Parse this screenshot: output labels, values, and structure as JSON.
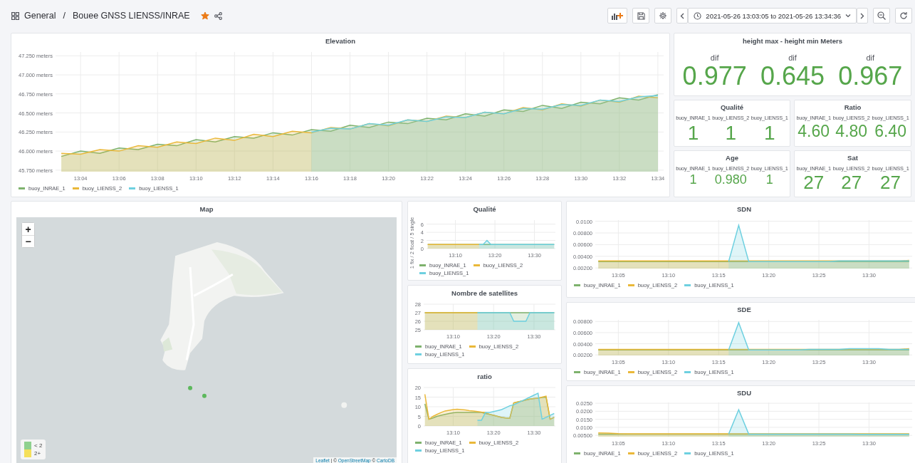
{
  "breadcrumb": {
    "folder": "General",
    "separator": "/",
    "dashboard": "Bouee GNSS LIENSS/INRAE",
    "starred": true
  },
  "time_range": "2021-05-26 13:03:05 to 2021-05-26 13:34:36",
  "elevation": {
    "title": "Elevation",
    "chart_data": {
      "type": "area",
      "grid": true,
      "ylim": [
        45.73,
        47.3
      ],
      "yticks": [
        {
          "value": 45.75,
          "label": "45.750 meters"
        },
        {
          "value": 46,
          "label": "46.000 meters"
        },
        {
          "value": 46.25,
          "label": "46.250 meters"
        },
        {
          "value": 46.5,
          "label": "46.500 meters"
        },
        {
          "value": 46.75,
          "label": "46.750 meters"
        },
        {
          "value": 47,
          "label": "47.000 meters"
        },
        {
          "value": 47.25,
          "label": "47.250 meters"
        }
      ],
      "categories": [
        null,
        "13:04",
        null,
        "13:06",
        null,
        "13:08",
        null,
        "13:10",
        null,
        "13:12",
        null,
        "13:14",
        null,
        "13:16",
        null,
        "13:18",
        null,
        "13:20",
        null,
        "13:22",
        null,
        "13:24",
        null,
        "13:26",
        null,
        "13:28",
        null,
        "13:30",
        null,
        "13:32",
        null,
        "13:34"
      ],
      "series": [
        {
          "name": "buoy_INRAE_1",
          "color": "#7eb26d",
          "values": [
            45.93,
            46.0,
            45.97,
            46.04,
            46.02,
            46.09,
            46.07,
            46.15,
            46.12,
            46.19,
            46.17,
            46.24,
            46.21,
            46.28,
            46.26,
            46.34,
            46.31,
            46.38,
            46.36,
            46.43,
            46.41,
            46.49,
            46.46,
            46.54,
            46.52,
            46.6,
            46.56,
            46.64,
            46.62,
            46.7,
            46.67,
            46.74
          ]
        },
        {
          "name": "buoy_LIENSS_2",
          "color": "#eab839",
          "values": [
            45.97,
            45.96,
            46.02,
            46.0,
            46.07,
            46.05,
            46.12,
            46.1,
            46.17,
            46.14,
            46.22,
            46.19,
            46.26,
            46.24,
            46.31,
            46.29,
            46.36,
            46.33,
            46.41,
            46.39,
            46.46,
            46.44,
            46.51,
            46.49,
            46.57,
            46.54,
            46.62,
            46.59,
            46.67,
            46.64,
            46.72,
            46.7
          ]
        },
        {
          "name": "buoy_LIENSS_1",
          "color": "#6ed0e0",
          "values": [
            null,
            null,
            null,
            null,
            null,
            null,
            null,
            null,
            null,
            null,
            null,
            null,
            null,
            46.25,
            46.3,
            46.29,
            46.36,
            46.34,
            46.41,
            46.39,
            46.45,
            46.44,
            46.51,
            46.49,
            46.56,
            46.55,
            46.61,
            46.6,
            46.67,
            46.65,
            46.71,
            46.73
          ]
        }
      ]
    }
  },
  "height_diff": {
    "title": "height max - height min Meters",
    "items": [
      {
        "label": "dif",
        "value": "0.977"
      },
      {
        "label": "dif",
        "value": "0.645"
      },
      {
        "label": "dif",
        "value": "0.967"
      }
    ]
  },
  "stat_panels": [
    {
      "title": "Qualité",
      "items": [
        {
          "label": "buoy_INRAE_1",
          "value": "1"
        },
        {
          "label": "buoy_LIENSS_2",
          "value": "1"
        },
        {
          "label": "buoy_LIENSS_1",
          "value": "1"
        }
      ]
    },
    {
      "title": "Ratio",
      "items": [
        {
          "label": "buoy_INRAE_1",
          "value": "4.60"
        },
        {
          "label": "buoy_LIENSS_2",
          "value": "4.80"
        },
        {
          "label": "buoy_LIENSS_1",
          "value": "6.40"
        }
      ]
    },
    {
      "title": "Age",
      "items": [
        {
          "label": "buoy_INRAE_1",
          "value": "1"
        },
        {
          "label": "buoy_LIENSS_2",
          "value": "0.980"
        },
        {
          "label": "buoy_LIENSS_1",
          "value": "1"
        }
      ]
    },
    {
      "title": "Sat",
      "items": [
        {
          "label": "buoy_INRAE_1",
          "value": "27"
        },
        {
          "label": "buoy_LIENSS_2",
          "value": "27"
        },
        {
          "label": "buoy_LIENSS_1",
          "value": "27"
        }
      ]
    }
  ],
  "map": {
    "title": "Map",
    "zoom_in": "+",
    "zoom_out": "−",
    "legend": [
      {
        "label": "< 2",
        "color": "#8fd18f"
      },
      {
        "label": "2+",
        "color": "#f5e05a"
      }
    ],
    "attribution": [
      {
        "kind": "link",
        "text": "Leaflet"
      },
      {
        "kind": "text",
        "text": " | © "
      },
      {
        "kind": "link",
        "text": "OpenStreetMap"
      },
      {
        "kind": "text",
        "text": " © "
      },
      {
        "kind": "link",
        "text": "CartoDB"
      }
    ]
  },
  "small_charts": [
    {
      "title": "Qualité",
      "chart_data": {
        "type": "area",
        "grid": true,
        "ylabel": "1 fix / 2 float / 5 single",
        "ylim": [
          0,
          7
        ],
        "yticks": [
          0,
          2,
          4,
          6
        ],
        "categories": [
          null,
          null,
          null,
          null,
          null,
          null,
          null,
          "13:10",
          null,
          null,
          null,
          null,
          null,
          null,
          null,
          null,
          null,
          "13:20",
          null,
          null,
          null,
          null,
          null,
          null,
          null,
          null,
          null,
          "13:30",
          null,
          null,
          null,
          null,
          null
        ],
        "series": [
          {
            "name": "buoy_INRAE_1",
            "color": "#7eb26d",
            "values": [
              1,
              1,
              1,
              1,
              1,
              1,
              1,
              1,
              1,
              1,
              1,
              1,
              1,
              1,
              1,
              1,
              1,
              1,
              1,
              1,
              1,
              1,
              1,
              1,
              1,
              1,
              1,
              1,
              1,
              1,
              1,
              1,
              1
            ]
          },
          {
            "name": "buoy_LIENSS_2",
            "color": "#eab839",
            "values": [
              1,
              1,
              1,
              1,
              1,
              1,
              1,
              1,
              1,
              1,
              1,
              1,
              1,
              1,
              null,
              null,
              null,
              null,
              null,
              null,
              null,
              null,
              null,
              null,
              null,
              null,
              null,
              null,
              null,
              null,
              null,
              null,
              null
            ]
          },
          {
            "name": "buoy_LIENSS_1",
            "color": "#6ed0e0",
            "values": [
              null,
              null,
              null,
              null,
              null,
              null,
              null,
              null,
              null,
              null,
              null,
              null,
              null,
              1,
              1,
              2,
              1,
              1,
              1,
              1,
              1,
              1,
              1,
              1,
              1,
              1,
              1,
              1,
              1,
              1,
              1,
              1,
              1
            ]
          }
        ]
      }
    },
    {
      "title": "Nombre de satellites",
      "chart_data": {
        "type": "area",
        "grid": true,
        "ylim": [
          25,
          28
        ],
        "yticks": [
          25,
          26,
          27,
          28
        ],
        "categories": [
          null,
          null,
          null,
          null,
          null,
          null,
          null,
          "13:10",
          null,
          null,
          null,
          null,
          null,
          null,
          null,
          null,
          null,
          "13:20",
          null,
          null,
          null,
          null,
          null,
          null,
          null,
          null,
          null,
          "13:30",
          null,
          null,
          null,
          null,
          null
        ],
        "series": [
          {
            "name": "buoy_INRAE_1",
            "color": "#7eb26d",
            "values": [
              27,
              27,
              27,
              27,
              27,
              27,
              27,
              27,
              27,
              27,
              27,
              27,
              27,
              27,
              27,
              27,
              27,
              27,
              27,
              27,
              27,
              27,
              27,
              27,
              27,
              27,
              27,
              27,
              27,
              27,
              27,
              27,
              27
            ]
          },
          {
            "name": "buoy_LIENSS_2",
            "color": "#eab839",
            "values": [
              27,
              27,
              27,
              27,
              27,
              27,
              27,
              27,
              27,
              27,
              27,
              27,
              27,
              27,
              null,
              null,
              null,
              null,
              null,
              null,
              null,
              null,
              null,
              null,
              null,
              null,
              null,
              null,
              null,
              null,
              null,
              null,
              null
            ]
          },
          {
            "name": "buoy_LIENSS_1",
            "color": "#6ed0e0",
            "values": [
              null,
              null,
              null,
              null,
              null,
              null,
              null,
              null,
              null,
              null,
              null,
              null,
              null,
              27,
              27,
              27,
              27,
              27,
              27,
              27,
              27,
              27,
              26,
              26,
              26,
              26,
              27,
              27,
              27,
              27,
              27,
              27,
              27
            ]
          }
        ]
      }
    },
    {
      "title": "ratio",
      "chart_data": {
        "type": "area",
        "grid": true,
        "ylim": [
          0,
          20
        ],
        "yticks": [
          0,
          5,
          10,
          15,
          20
        ],
        "categories": [
          null,
          null,
          null,
          null,
          null,
          null,
          null,
          "13:10",
          null,
          null,
          null,
          null,
          null,
          null,
          null,
          null,
          null,
          "13:20",
          null,
          null,
          null,
          null,
          null,
          null,
          null,
          null,
          null,
          "13:30",
          null,
          null,
          null,
          null,
          null
        ],
        "series": [
          {
            "name": "buoy_INRAE_1",
            "color": "#7eb26d",
            "values": [
              11.5,
              3.5,
              4.2,
              5,
              5.5,
              6,
              6.5,
              6.8,
              7,
              7,
              7,
              7,
              7,
              7,
              7,
              6.5,
              6,
              5.5,
              5,
              4.5,
              4.2,
              4,
              12,
              12.5,
              13,
              13.5,
              14,
              14.3,
              14.5,
              14.8,
              15,
              3.5,
              4.5
            ]
          },
          {
            "name": "buoy_LIENSS_2",
            "color": "#eab839",
            "values": [
              16.5,
              3.5,
              5,
              6,
              7,
              7.8,
              8.2,
              8.5,
              8.7,
              8.5,
              8.3,
              8,
              7.8,
              7.5,
              7.2,
              7,
              6,
              5.5,
              5,
              4.5,
              4.2,
              4,
              12,
              12.5,
              13,
              13.5,
              14,
              14.3,
              14.5,
              15,
              15.5,
              3.5,
              4.5
            ]
          },
          {
            "name": "buoy_LIENSS_1",
            "color": "#6ed0e0",
            "values": [
              null,
              null,
              null,
              null,
              null,
              null,
              null,
              null,
              null,
              null,
              null,
              null,
              null,
              3,
              3,
              7,
              7,
              7.5,
              8,
              8.5,
              9.5,
              10.5,
              11,
              12,
              13,
              14,
              15,
              16,
              17,
              3.5,
              4.5,
              5.5,
              6.5
            ]
          }
        ]
      }
    }
  ],
  "sd_charts": [
    {
      "title": "SDN",
      "chart_data": {
        "type": "area",
        "grid": true,
        "ylim": [
          0.0019,
          0.0102
        ],
        "yticks": [
          {
            "value": 0.002,
            "label": "0.00200"
          },
          {
            "value": 0.004,
            "label": "0.00400"
          },
          {
            "value": 0.006,
            "label": "0.00600"
          },
          {
            "value": 0.008,
            "label": "0.00800"
          },
          {
            "value": 0.01,
            "label": "0.0100"
          }
        ],
        "categories": [
          null,
          null,
          "13:05",
          null,
          null,
          null,
          null,
          "13:10",
          null,
          null,
          null,
          null,
          "13:15",
          null,
          null,
          null,
          null,
          "13:20",
          null,
          null,
          null,
          null,
          "13:25",
          null,
          null,
          null,
          null,
          "13:30",
          null,
          null,
          null,
          null
        ],
        "series": [
          {
            "name": "buoy_INRAE_1",
            "color": "#7eb26d",
            "values": [
              0.0031,
              0.0031,
              0.0031,
              0.0031,
              0.0031,
              0.0031,
              0.0031,
              0.0031,
              0.0031,
              0.0031,
              0.0031,
              0.0031,
              0.0031,
              0.0031,
              0.0031,
              0.0031,
              0.0031,
              0.0031,
              0.0031,
              0.0031,
              0.0031,
              0.0031,
              0.0031,
              0.0031,
              0.0031,
              0.0031,
              0.0031,
              0.0031,
              0.0031,
              0.0031,
              0.0031,
              0.0031
            ]
          },
          {
            "name": "buoy_LIENSS_2",
            "color": "#eab839",
            "values": [
              0.0032,
              0.0032,
              0.0032,
              0.0032,
              0.0032,
              0.0032,
              0.0032,
              0.0032,
              0.0032,
              0.0032,
              0.0032,
              0.0032,
              0.0032,
              0.0032,
              0.0032,
              0.0032,
              0.0032,
              0.0032,
              0.0032,
              0.0032,
              0.0032,
              0.0032,
              0.0032,
              0.0032,
              0.0032,
              0.0032,
              0.0032,
              0.0032,
              0.0032,
              0.0032,
              0.0032,
              0.0033
            ]
          },
          {
            "name": "buoy_LIENSS_1",
            "color": "#6ed0e0",
            "values": [
              null,
              null,
              null,
              null,
              null,
              null,
              null,
              null,
              null,
              null,
              null,
              null,
              null,
              0.0031,
              0.0093,
              0.0031,
              0.0031,
              0.0031,
              0.0031,
              0.0031,
              0.0031,
              0.0031,
              0.0031,
              0.0031,
              0.0032,
              0.0032,
              0.0032,
              0.0032,
              0.0032,
              0.0032,
              0.0032,
              0.0032
            ]
          }
        ]
      }
    },
    {
      "title": "SDE",
      "chart_data": {
        "type": "area",
        "grid": true,
        "ylim": [
          0.0019,
          0.0083
        ],
        "yticks": [
          {
            "value": 0.002,
            "label": "0.00200"
          },
          {
            "value": 0.004,
            "label": "0.00400"
          },
          {
            "value": 0.006,
            "label": "0.00600"
          },
          {
            "value": 0.008,
            "label": "0.00800"
          }
        ],
        "categories": [
          null,
          null,
          "13:05",
          null,
          null,
          null,
          null,
          "13:10",
          null,
          null,
          null,
          null,
          "13:15",
          null,
          null,
          null,
          null,
          "13:20",
          null,
          null,
          null,
          null,
          "13:25",
          null,
          null,
          null,
          null,
          "13:30",
          null,
          null,
          null,
          null
        ],
        "series": [
          {
            "name": "buoy_INRAE_1",
            "color": "#7eb26d",
            "values": [
              0.0029,
              0.0029,
              0.0029,
              0.0029,
              0.0029,
              0.0029,
              0.0029,
              0.0029,
              0.0029,
              0.0029,
              0.0029,
              0.0029,
              0.0029,
              0.0029,
              0.0029,
              0.0029,
              0.0029,
              0.0029,
              0.0029,
              0.0029,
              0.0029,
              0.0029,
              0.0029,
              0.0029,
              0.0029,
              0.0029,
              0.0029,
              0.0029,
              0.0029,
              0.0029,
              0.0029,
              0.0029
            ]
          },
          {
            "name": "buoy_LIENSS_2",
            "color": "#eab839",
            "values": [
              0.003,
              0.003,
              0.003,
              0.003,
              0.003,
              0.003,
              0.003,
              0.003,
              0.003,
              0.003,
              0.003,
              0.003,
              0.003,
              0.003,
              0.003,
              0.003,
              0.003,
              0.003,
              0.003,
              0.003,
              0.003,
              0.003,
              0.003,
              0.003,
              0.003,
              0.003,
              0.003,
              0.003,
              0.003,
              0.003,
              0.003,
              0.0031
            ]
          },
          {
            "name": "buoy_LIENSS_1",
            "color": "#6ed0e0",
            "values": [
              null,
              null,
              null,
              null,
              null,
              null,
              null,
              null,
              null,
              null,
              null,
              null,
              null,
              0.0029,
              0.0078,
              0.0029,
              0.0029,
              0.0029,
              0.0029,
              0.0029,
              0.0029,
              0.003,
              0.003,
              0.003,
              0.003,
              0.0031,
              0.0031,
              0.0031,
              0.0031,
              0.003,
              0.003,
              0.003
            ]
          }
        ]
      }
    },
    {
      "title": "SDU",
      "chart_data": {
        "type": "area",
        "grid": true,
        "ylim": [
          0.0042,
          0.0255
        ],
        "yticks": [
          {
            "value": 0.005,
            "label": "0.00500"
          },
          {
            "value": 0.01,
            "label": "0.0100"
          },
          {
            "value": 0.015,
            "label": "0.0150"
          },
          {
            "value": 0.02,
            "label": "0.0200"
          },
          {
            "value": 0.025,
            "label": "0.0250"
          }
        ],
        "categories": [
          null,
          null,
          "13:05",
          null,
          null,
          null,
          null,
          "13:10",
          null,
          null,
          null,
          null,
          "13:15",
          null,
          null,
          null,
          null,
          "13:20",
          null,
          null,
          null,
          null,
          "13:25",
          null,
          null,
          null,
          null,
          "13:30",
          null,
          null,
          null,
          null
        ],
        "series": [
          {
            "name": "buoy_INRAE_1",
            "color": "#7eb26d",
            "values": [
              0.0058,
              0.0058,
              0.0058,
              0.0058,
              0.0058,
              0.0058,
              0.0058,
              0.0058,
              0.0058,
              0.0058,
              0.0058,
              0.0058,
              0.0058,
              0.0058,
              0.0058,
              0.0058,
              0.0058,
              0.0058,
              0.0058,
              0.0058,
              0.0058,
              0.0058,
              0.0058,
              0.0058,
              0.0058,
              0.0058,
              0.0058,
              0.0058,
              0.0057,
              0.0057,
              0.0057,
              0.0057
            ]
          },
          {
            "name": "buoy_LIENSS_2",
            "color": "#eab839",
            "values": [
              0.0065,
              0.0064,
              0.0061,
              0.006,
              0.006,
              0.006,
              0.006,
              0.006,
              0.006,
              0.006,
              0.006,
              0.006,
              0.006,
              0.006,
              0.006,
              0.006,
              0.006,
              0.006,
              0.006,
              0.006,
              0.006,
              0.006,
              0.006,
              0.006,
              0.006,
              0.006,
              0.006,
              0.006,
              0.006,
              0.006,
              0.006,
              0.006
            ]
          },
          {
            "name": "buoy_LIENSS_1",
            "color": "#6ed0e0",
            "values": [
              null,
              null,
              null,
              null,
              null,
              null,
              null,
              null,
              null,
              null,
              null,
              null,
              null,
              0.0058,
              0.021,
              0.0058,
              0.0058,
              0.0058,
              0.0058,
              0.0058,
              0.0058,
              0.0058,
              0.0058,
              0.0057,
              0.0057,
              0.0057,
              0.0056,
              0.0056,
              0.0056,
              0.0056,
              0.0056,
              0.0056
            ]
          }
        ]
      }
    }
  ]
}
